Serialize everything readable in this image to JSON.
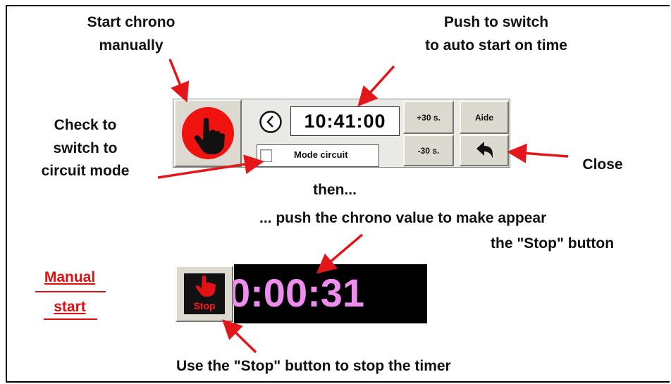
{
  "annotations": {
    "start_chrono": [
      "Start chrono",
      "manually"
    ],
    "push_switch": [
      "Push to switch",
      "to auto start on time"
    ],
    "check_circuit": [
      "Check to",
      "switch to",
      "circuit mode"
    ],
    "close": "Close",
    "then": "then...",
    "push_chrono": "... push the chrono value to make appear",
    "stop_button": "the \"Stop\" button",
    "use_stop": "Use the \"Stop\" button to stop the timer",
    "manual_start": [
      "Manual",
      "start"
    ]
  },
  "toolbar": {
    "time": "10:41:00",
    "plus30": "+30 s.",
    "minus30": "-30 s.",
    "aide": "Aide",
    "mode_circuit": "Mode circuit",
    "mode_circuit_checked": false
  },
  "chrono": {
    "value": "0:00:31",
    "stop_label": "Stop"
  },
  "colors": {
    "red_button": "#f0120e",
    "chrono_text": "#ee8cef",
    "arrow": "#e4161a",
    "manual_label": "#e01010"
  },
  "icons": [
    "hand-icon",
    "clock-icon",
    "undo-arrow-icon",
    "stop-hand-icon"
  ]
}
